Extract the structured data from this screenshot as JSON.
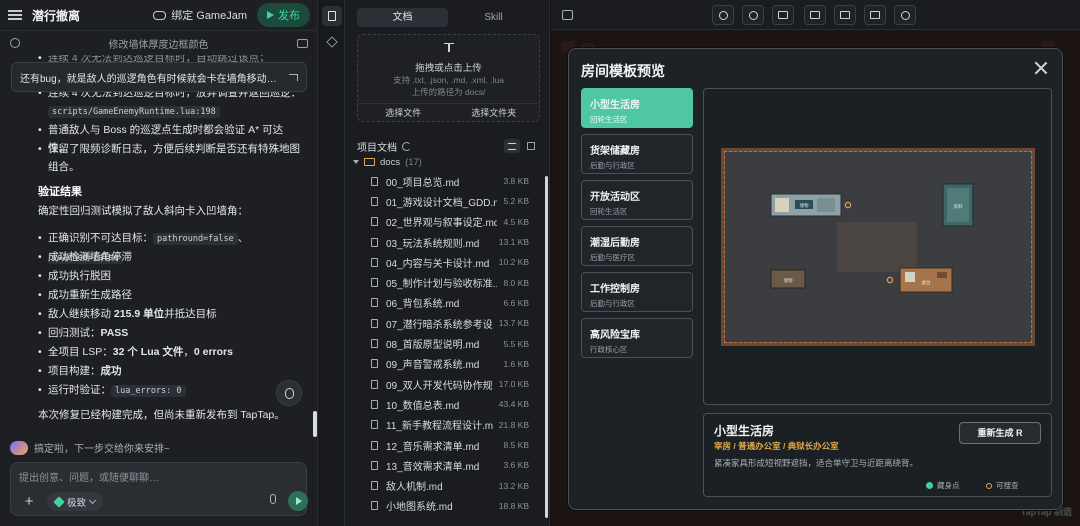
{
  "app": {
    "title": "潜行撤离",
    "bind_label": "绑定 GameJam",
    "publish_label": "发布"
  },
  "thread": {
    "title": "修改墙体厚度边框颜色",
    "quote": "还有bug，就是敌人的巡逻角色有时候就会卡在墙角移动不动的，…"
  },
  "chat": {
    "partial_line": "连续 4 次无法到达巡逻目标时，自动跳过该点；",
    "bullets_top": [
      {
        "text": "连续 4 次无法到达巡逻目标时，放弃调查并返回巡逻："
      },
      {
        "text": "普通敌人与 Boss 的巡逻点生成时都会验证 A* 可达性。"
      },
      {
        "text": "保留了限频诊断日志，方便后续判断是否还有特殊地图组合。"
      }
    ],
    "code_path": "scripts/GameEnemyRuntime.lua:198",
    "section_title": "验证结果",
    "intro": "确定性回归测试模拟了敌人斜向卡入凹墙角：",
    "bullet1_prefix": "正确识别不可达目标：",
    "bullet1_code1": "pathround=false",
    "bullet1_sep": "、",
    "bullet1_code2": "reached=false",
    "bullet2": "成功检测墙角停滞",
    "bullet3": "成功执行脱困",
    "bullet4": "成功重新生成路径",
    "bullet5_prefix": "敌人继续移动 ",
    "bullet5_bold": "215.9 单位",
    "bullet5_suffix": "并抵达目标",
    "bullet6_prefix": "回归测试：",
    "bullet6_bold": "PASS",
    "bullet7_prefix": "全项目 LSP：",
    "bullet7_bold1": "32 个 Lua 文件",
    "bullet7_mid": "，",
    "bullet7_bold2": "0 errors",
    "bullet8_prefix": "项目构建：",
    "bullet8_bold": "成功",
    "bullet9_prefix": "运行时验证：",
    "bullet9_code": "lua_errors: 0",
    "conclusion": "本次修复已经构建完成，但尚未重新发布到 TapTap。",
    "status": "搞定啦，下一步交给你来安排~"
  },
  "input": {
    "placeholder": "提出创意、问题，或随便聊聊…",
    "mode_label": "极致"
  },
  "docs": {
    "tabs": [
      "文档",
      "Skill"
    ],
    "upload_title": "拖拽或点击上传",
    "upload_formats": "支持 .txt, .json, .md, .xml, .lua",
    "upload_target": "上传的路径为 docs/",
    "select_file": "选择文件",
    "select_folder": "选择文件夹",
    "project_docs": "项目文档",
    "folder_name": "docs",
    "folder_count": "(17)",
    "files": [
      {
        "name": "00_项目总览.md",
        "size": "3.8 KB"
      },
      {
        "name": "01_游戏设计文档_GDD.md",
        "size": "5.2 KB"
      },
      {
        "name": "02_世界观与叙事设定.md",
        "size": "4.5 KB"
      },
      {
        "name": "03_玩法系统规则.md",
        "size": "13.1 KB"
      },
      {
        "name": "04_内容与关卡设计.md",
        "size": "10.2 KB"
      },
      {
        "name": "05_制作计划与验收标准...",
        "size": "8.0 KB"
      },
      {
        "name": "06_背包系统.md",
        "size": "6.6 KB"
      },
      {
        "name": "07_潜行暗杀系统参考设...",
        "size": "13.7 KB"
      },
      {
        "name": "08_首版原型说明.md",
        "size": "5.5 KB"
      },
      {
        "name": "09_声音警戒系统.md",
        "size": "1.6 KB"
      },
      {
        "name": "09_双人开发代码协作规...",
        "size": "17.0 KB"
      },
      {
        "name": "10_数值总表.md",
        "size": "43.4 KB"
      },
      {
        "name": "11_新手教程流程设计.md",
        "size": "21.8 KB"
      },
      {
        "name": "12_音乐需求清单.md",
        "size": "8.5 KB"
      },
      {
        "name": "13_音效需求清单.md",
        "size": "3.6 KB"
      },
      {
        "name": "敌人机制.md",
        "size": "13.2 KB"
      },
      {
        "name": "小地图系统.md",
        "size": "18.8 KB"
      }
    ]
  },
  "modal": {
    "title": "房间模板预览",
    "rooms": [
      {
        "name": "小型生活房",
        "sub": "回轮生活区"
      },
      {
        "name": "货架储藏房",
        "sub": "后勤与行政区"
      },
      {
        "name": "开放活动区",
        "sub": "回轮生活区"
      },
      {
        "name": "潮湿后勤房",
        "sub": "后勤与医疗区"
      },
      {
        "name": "工作控制房",
        "sub": "后勤与行政区"
      },
      {
        "name": "高风险宝库",
        "sub": "行政核心区"
      }
    ],
    "selected": {
      "name": "小型生活房",
      "tags": "宰房 / 普通办公室 / 典狱长办公室",
      "desc": "紧凑家具形成短视野遮挡，适合单守卫与近距离绕背。",
      "regen_label": "重新生成  R"
    },
    "legend": [
      {
        "label": "藏身点",
        "color": "#4fc7a3"
      },
      {
        "label": "可搜查",
        "color": "#e0a94a"
      }
    ],
    "furniture_labels": [
      "储物",
      "资料",
      "储物",
      "桌台"
    ]
  },
  "watermark": "TapTap 制造",
  "colors": {
    "accent": "#40d39b",
    "active_room": "#4fc7a3",
    "gold": "#e0a94a"
  }
}
